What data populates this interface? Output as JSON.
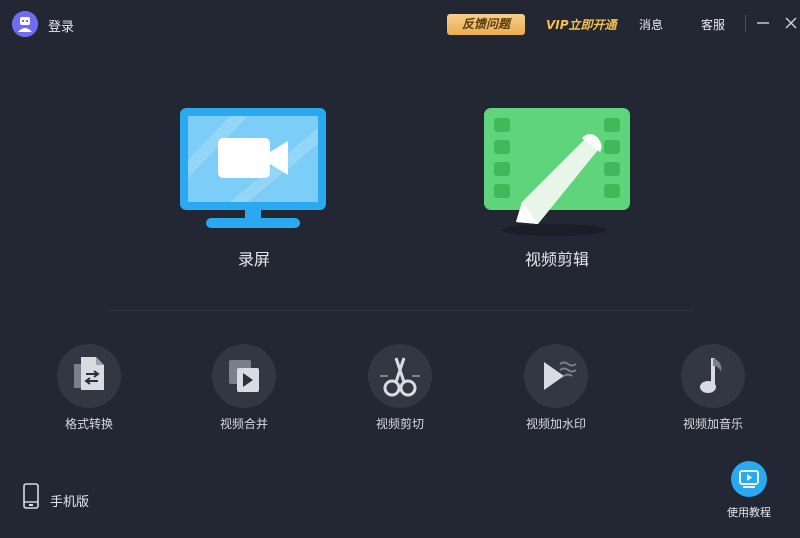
{
  "colors": {
    "background": "#232733",
    "feedback_bg": "#f0c06f",
    "vip": "#f2c14e",
    "record_blue": "#2aa8f0",
    "edit_green": "#5fd47a",
    "tutorial_blue": "#2aa8f0",
    "tool_circle": "#323743"
  },
  "titlebar": {
    "avatar_icon": "user-avatar-icon",
    "login_label": "登录",
    "feedback_label": "反馈问题",
    "vip_label": "VIP立即开通",
    "messages_label": "消息",
    "service_label": "客服"
  },
  "main": {
    "record": {
      "label": "录屏",
      "icon": "monitor-camera-icon"
    },
    "edit": {
      "label": "视频剪辑",
      "icon": "film-pen-icon"
    }
  },
  "tools": [
    {
      "label": "格式转换",
      "icon": "format-convert-icon"
    },
    {
      "label": "视频合并",
      "icon": "video-merge-icon"
    },
    {
      "label": "视频剪切",
      "icon": "scissors-icon"
    },
    {
      "label": "视频加水印",
      "icon": "watermark-play-icon"
    },
    {
      "label": "视频加音乐",
      "icon": "music-note-icon"
    }
  ],
  "footer": {
    "mobile_label": "手机版",
    "tutorial_label": "使用教程"
  }
}
